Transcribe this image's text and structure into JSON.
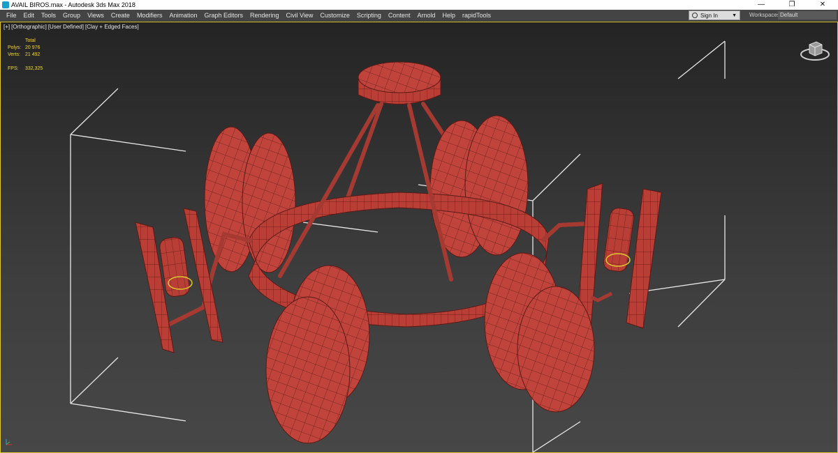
{
  "window": {
    "title": "AVAIL BIROS.max - Autodesk 3ds Max 2018",
    "app_icon": "3ds-max-icon",
    "controls": {
      "minimize": "—",
      "restore": "❐",
      "close": "✕"
    }
  },
  "menubar": {
    "items": [
      "File",
      "Edit",
      "Tools",
      "Group",
      "Views",
      "Create",
      "Modifiers",
      "Animation",
      "Graph Editors",
      "Rendering",
      "Civil View",
      "Customize",
      "Scripting",
      "Content",
      "Arnold",
      "Help",
      "rapidTools"
    ],
    "sign_in": "Sign In",
    "workspaces_label": "Workspaces:",
    "workspaces_value": "Default"
  },
  "viewport": {
    "labels": [
      "[+]",
      "[Orthographic]",
      "[User Defined]",
      "[Clay + Edged Faces]"
    ],
    "stats": {
      "header": "Total",
      "polys_label": "Polys:",
      "polys_value": "20 976",
      "verts_label": "Verts:",
      "verts_value": "21 492",
      "fps_label": "FPS:",
      "fps_value": "332,325"
    },
    "model_color": "#c0443c",
    "selection_color": "#e0c830",
    "viewcube_icon": "viewcube-icon",
    "axis_icon": "axis-tripod-icon"
  }
}
